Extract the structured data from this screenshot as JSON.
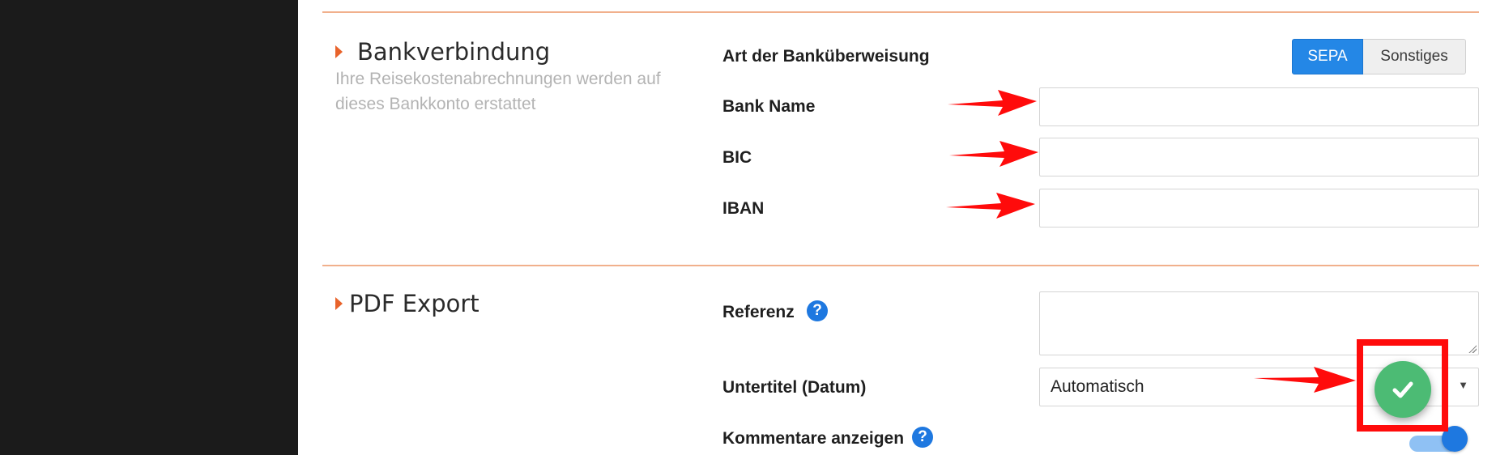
{
  "bank_section": {
    "title": "Bankverbindung",
    "description": "Ihre Reisekostenabrechnungen werden auf dieses Bankkonto erstattet",
    "transfer_type_label": "Art der Banküberweisung",
    "transfer_options": [
      "SEPA",
      "Sonstiges"
    ],
    "selected_option": "SEPA",
    "bank_name_label": "Bank Name",
    "bank_name_value": "",
    "bic_label": "BIC",
    "bic_value": "",
    "iban_label": "IBAN",
    "iban_value": ""
  },
  "pdf_section": {
    "title": "PDF Export",
    "reference_label": "Referenz",
    "reference_value": "",
    "subtitle_label": "Untertitel (Datum)",
    "subtitle_value": "Automatisch",
    "comments_label": "Kommentare anzeigen",
    "comments_enabled": true,
    "help_icon": "question-circle-icon"
  },
  "save_fab": {
    "icon": "check-icon",
    "color": "#4cbb74"
  },
  "annotation": {
    "arrow_color": "#ff0b0b",
    "box_color": "#ff0b0b"
  },
  "colors": {
    "accent": "#e8632b",
    "primary": "#2487e6",
    "divider": "#f1b08c",
    "sidebar": "#1b1b1b"
  }
}
